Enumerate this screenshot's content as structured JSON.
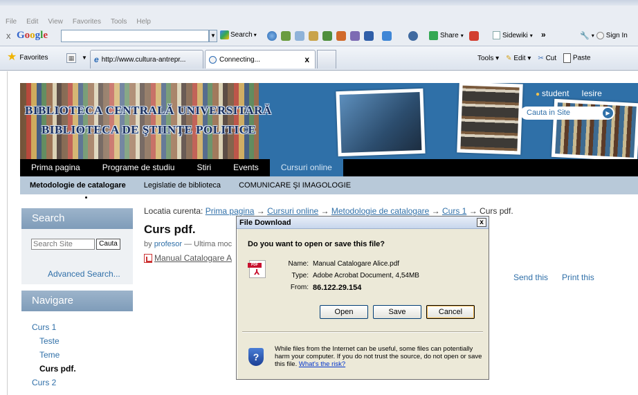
{
  "browser": {
    "menu": [
      "File",
      "Edit",
      "View",
      "Favorites",
      "Tools",
      "Help"
    ],
    "google_toolbar": {
      "close": "x",
      "logo": "Google",
      "search_label": "Search",
      "share_label": "Share",
      "sidewiki_label": "Sidewiki",
      "more": "»",
      "signin_label": "Sign In"
    },
    "favorites_label": "Favorites",
    "tabs": [
      {
        "label": "http://www.cultura-antrepr..."
      },
      {
        "label": "Connecting...",
        "close": "x"
      }
    ],
    "commands": {
      "tools": "Tools",
      "edit": "Edit",
      "cut": "Cut",
      "paste": "Paste"
    }
  },
  "site": {
    "title_line1": "BIBLIOTECA CENTRALĂ UNIVERSITARĂ",
    "title_line2": "BIBLIOTECA DE ŞTIINŢE POLITICE",
    "user": "student",
    "logout": "Iesire",
    "site_search_placeholder": "Cauta in Site",
    "main_nav": [
      "Prima pagina",
      "Programe de studiu",
      "Stiri",
      "Events",
      "Cursuri online"
    ],
    "sub_nav": [
      "Metodologie de catalogare",
      "Legislatie de biblioteca",
      "COMUNICARE ŞI IMAGOLOGIE"
    ]
  },
  "sidebar": {
    "search_title": "Search",
    "search_placeholder": "Search Site",
    "search_button": "Cauta",
    "advanced_search": "Advanced Search...",
    "nav_title": "Navigare",
    "nav_items": [
      "Curs 1",
      "Teste",
      "Teme",
      "Curs pdf.",
      "Curs 2"
    ]
  },
  "content": {
    "breadcrumb_label": "Locatia curenta:",
    "breadcrumb": [
      "Prima pagina",
      "Cursuri online",
      "Metodologie de catalogare",
      "Curs 1",
      "Curs pdf."
    ],
    "arrow": "→",
    "title": "Curs pdf.",
    "byline_by": "by",
    "byline_author": "profesor",
    "byline_rest": "— Ultima moc",
    "file_link": "Manual Catalogare A",
    "send_this": "Send this",
    "print_this": "Print this"
  },
  "dialog": {
    "title": "File Download",
    "close": "x",
    "question": "Do you want to open or save this file?",
    "icon_band": "PDF",
    "name_label": "Name:",
    "name_value": "Manual Catalogare Alice.pdf",
    "type_label": "Type:",
    "type_value": "Adobe Acrobat Document, 4,54MB",
    "from_label": "From:",
    "from_value": "86.122.29.154",
    "buttons": {
      "open": "Open",
      "save": "Save",
      "cancel": "Cancel"
    },
    "warning_text": "While files from the Internet can be useful, some files can potentially harm your computer. If you do not trust the source, do not open or save this file.",
    "warning_link": "What's the risk?"
  }
}
